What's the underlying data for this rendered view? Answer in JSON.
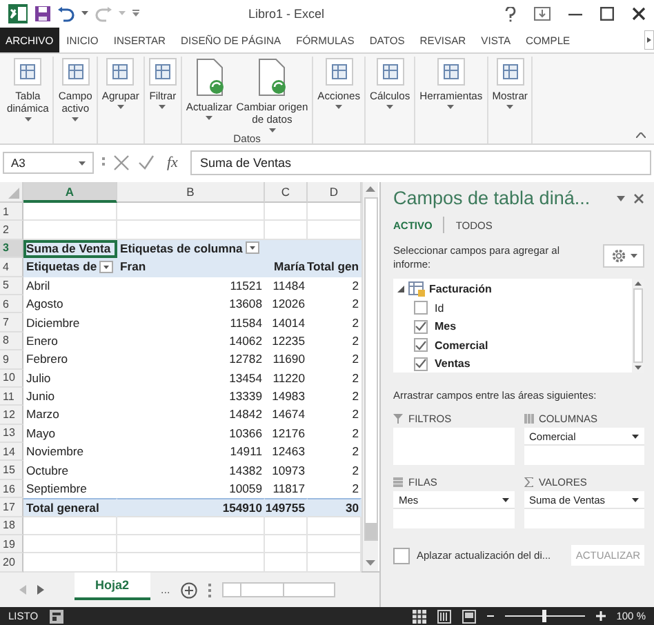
{
  "window": {
    "title": "Libro1 - Excel"
  },
  "ribbon_tabs": [
    {
      "label": "ARCHIVO",
      "kind": "file"
    },
    {
      "label": "INICIO",
      "kind": "tab"
    },
    {
      "label": "INSERTAR",
      "kind": "tab"
    },
    {
      "label": "DISEÑO DE PÁGINA",
      "kind": "tab"
    },
    {
      "label": "FÓRMULAS",
      "kind": "tab"
    },
    {
      "label": "DATOS",
      "kind": "tab"
    },
    {
      "label": "REVISAR",
      "kind": "tab"
    },
    {
      "label": "VISTA",
      "kind": "tab"
    },
    {
      "label": "COMPLE",
      "kind": "tab"
    }
  ],
  "ribbon_groups": [
    {
      "buttons": [
        {
          "label": "Tabla\ndinámica",
          "kind": "small",
          "dropdown": true
        }
      ]
    },
    {
      "buttons": [
        {
          "label": "Campo\nactivo",
          "kind": "small",
          "dropdown": true
        }
      ]
    },
    {
      "buttons": [
        {
          "label": "Agrupar",
          "kind": "small",
          "dropdown": true
        }
      ]
    },
    {
      "buttons": [
        {
          "label": "Filtrar",
          "kind": "small",
          "dropdown": true
        }
      ]
    },
    {
      "label": "Datos",
      "buttons": [
        {
          "label": "Actualizar",
          "kind": "large",
          "dropdown": true
        },
        {
          "label": "Cambiar origen\nde datos",
          "kind": "large",
          "dropdown": true
        }
      ]
    },
    {
      "buttons": [
        {
          "label": "Acciones",
          "kind": "small",
          "dropdown": true
        }
      ]
    },
    {
      "buttons": [
        {
          "label": "Cálculos",
          "kind": "small",
          "dropdown": true
        }
      ]
    },
    {
      "buttons": [
        {
          "label": "Herramientas",
          "kind": "small",
          "dropdown": true
        }
      ]
    },
    {
      "buttons": [
        {
          "label": "Mostrar",
          "kind": "small",
          "dropdown": true
        }
      ]
    }
  ],
  "formula_bar": {
    "name_box": "A3",
    "function_label": "fx",
    "value": "Suma de Ventas"
  },
  "grid": {
    "columns": [
      {
        "label": "A",
        "selected": true
      },
      {
        "label": "B",
        "selected": false
      },
      {
        "label": "C",
        "selected": false
      },
      {
        "label": "D",
        "selected": false
      }
    ],
    "rows": [
      {
        "number": "1",
        "kind": "blank",
        "selected": false
      },
      {
        "number": "2",
        "kind": "blank",
        "selected": false
      },
      {
        "number": "3",
        "kind": "pivot-header",
        "selected": true,
        "cells": [
          {
            "text": "Suma de Venta",
            "filter": false
          },
          {
            "text": "Etiquetas de columna",
            "filter": true
          }
        ]
      },
      {
        "number": "4",
        "kind": "pivot-header",
        "selected": false,
        "cells": [
          {
            "text": "Etiquetas de",
            "filter": true
          },
          {
            "text": "Fran",
            "filter": false
          },
          {
            "text": "María",
            "filter": false
          },
          {
            "text": "Total gen",
            "filter": false
          }
        ]
      },
      {
        "number": "5",
        "kind": "data",
        "selected": false,
        "cells": [
          "Abril",
          "11521",
          "11484",
          "2"
        ]
      },
      {
        "number": "6",
        "kind": "data",
        "selected": false,
        "cells": [
          "Agosto",
          "13608",
          "12026",
          "2"
        ]
      },
      {
        "number": "7",
        "kind": "data",
        "selected": false,
        "cells": [
          "Diciembre",
          "11584",
          "14014",
          "2"
        ]
      },
      {
        "number": "8",
        "kind": "data",
        "selected": false,
        "cells": [
          "Enero",
          "14062",
          "12235",
          "2"
        ]
      },
      {
        "number": "9",
        "kind": "data",
        "selected": false,
        "cells": [
          "Febrero",
          "12782",
          "11690",
          "2"
        ]
      },
      {
        "number": "10",
        "kind": "data",
        "selected": false,
        "cells": [
          "Julio",
          "13454",
          "11220",
          "2"
        ]
      },
      {
        "number": "11",
        "kind": "data",
        "selected": false,
        "cells": [
          "Junio",
          "13339",
          "14983",
          "2"
        ]
      },
      {
        "number": "12",
        "kind": "data",
        "selected": false,
        "cells": [
          "Marzo",
          "14842",
          "14674",
          "2"
        ]
      },
      {
        "number": "13",
        "kind": "data",
        "selected": false,
        "cells": [
          "Mayo",
          "10366",
          "12176",
          "2"
        ]
      },
      {
        "number": "14",
        "kind": "data",
        "selected": false,
        "cells": [
          "Noviembre",
          "14911",
          "12463",
          "2"
        ]
      },
      {
        "number": "15",
        "kind": "data",
        "selected": false,
        "cells": [
          "Octubre",
          "14382",
          "10973",
          "2"
        ]
      },
      {
        "number": "16",
        "kind": "data",
        "selected": false,
        "cells": [
          "Septiembre",
          "10059",
          "11817",
          "2"
        ]
      },
      {
        "number": "17",
        "kind": "total",
        "selected": false,
        "cells": [
          "Total general",
          "154910",
          "149755",
          "30"
        ]
      },
      {
        "number": "18",
        "kind": "blank",
        "selected": false
      },
      {
        "number": "19",
        "kind": "blank",
        "selected": false
      },
      {
        "number": "20",
        "kind": "blank",
        "selected": false
      }
    ]
  },
  "sheet_tabs": [
    {
      "label": "Hoja2",
      "selected": true
    }
  ],
  "sheet_more": "...",
  "pivot_pane": {
    "title": "Campos de tabla diná...",
    "tabs": [
      {
        "label": "ACTIVO",
        "selected": true
      },
      {
        "label": "TODOS",
        "selected": false
      }
    ],
    "instruction": "Seleccionar campos para agregar al informe:",
    "fields": [
      {
        "label": "Facturación",
        "expanded": true,
        "children": [
          {
            "label": "Id",
            "checked": false
          },
          {
            "label": "Mes",
            "checked": true
          },
          {
            "label": "Comercial",
            "checked": true
          },
          {
            "label": "Ventas",
            "checked": true
          }
        ]
      }
    ],
    "areas_hint": "Arrastrar campos entre las áreas siguientes:",
    "areas": [
      {
        "label": "FILTROS",
        "kind": "filters"
      },
      {
        "label": "COLUMNAS",
        "kind": "columns",
        "items": [
          "Comercial"
        ]
      },
      {
        "label": "FILAS",
        "kind": "rows",
        "items": [
          "Mes"
        ]
      },
      {
        "label": "VALORES",
        "kind": "values",
        "items": [
          "Suma de Ventas"
        ]
      }
    ],
    "defer": {
      "label": "Aplazar actualización del di...",
      "checked": false
    },
    "update_button": {
      "label": "ACTUALIZAR",
      "disabled": true
    }
  },
  "status_bar": {
    "status": "LISTO",
    "zoom": "100 %",
    "zoom_level": {
      "level": 0.5
    }
  }
}
